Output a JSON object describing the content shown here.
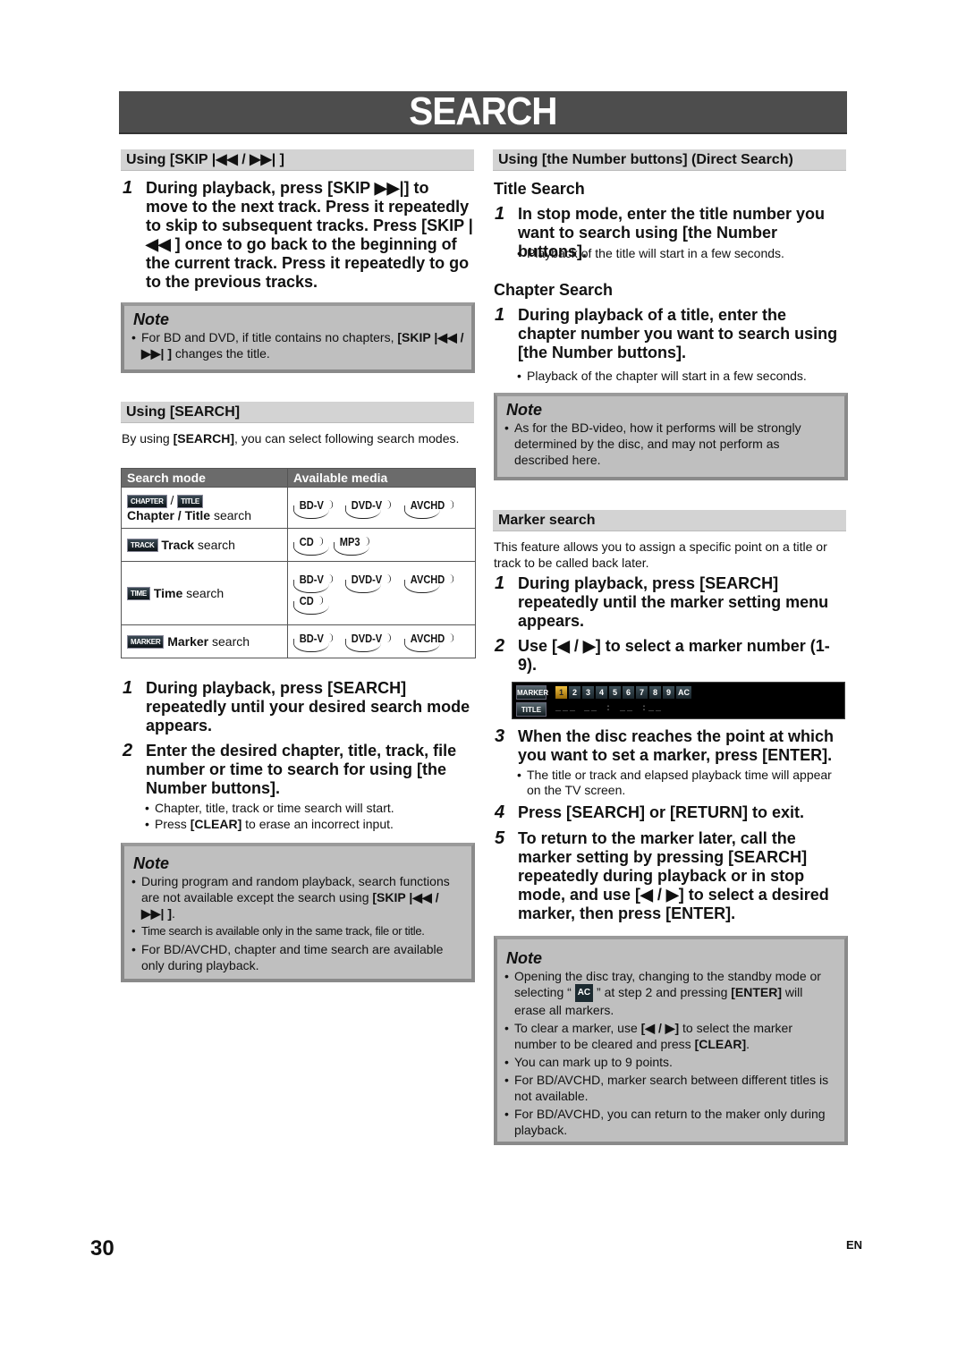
{
  "page": {
    "title": "SEARCH",
    "page_number": "30",
    "language": "EN"
  },
  "left": {
    "skip": {
      "heading": "Using [SKIP |◀◀ / ▶▶| ]",
      "step1_num": "1",
      "step1": "During playback, press [SKIP ▶▶|] to move to the next track. Press it repeatedly to skip to subsequent tracks. Press [SKIP |◀◀ ] once to go back to the beginning of the current track. Press it repeatedly to go to the previous tracks.",
      "note_title": "Note",
      "note_items": [
        {
          "pre": "For BD and DVD, if title contains no chapters, ",
          "bold": "[SKIP |◀◀ / ▶▶| ]",
          "post": " changes the title."
        }
      ]
    },
    "search": {
      "heading": "Using [SEARCH]",
      "intro_pre": "By using ",
      "intro_bold": "[SEARCH]",
      "intro_post": ", you can select following search modes.",
      "table": {
        "headers": [
          "Search mode",
          "Available media"
        ],
        "rows": [
          {
            "badges": [
              "CHAPTER",
              "TITLE"
            ],
            "bold": "Chapter / Title",
            "text": " search",
            "media": [
              [
                "BD-V",
                "DVD-V",
                "AVCHD"
              ]
            ]
          },
          {
            "badges": [
              "TRACK"
            ],
            "bold": "Track",
            "text": " search",
            "media": [
              [
                "CD",
                "MP3"
              ]
            ]
          },
          {
            "badges": [
              "TIME"
            ],
            "bold": "Time",
            "text": " search",
            "media": [
              [
                "BD-V",
                "DVD-V",
                "AVCHD"
              ],
              [
                "CD"
              ]
            ]
          },
          {
            "badges": [
              "MARKER"
            ],
            "bold": "Marker",
            "text": " search",
            "media": [
              [
                "BD-V",
                "DVD-V",
                "AVCHD"
              ]
            ]
          }
        ]
      },
      "steps": [
        {
          "num": "1",
          "text": "During playback, press [SEARCH] repeatedly until your desired search mode appears."
        },
        {
          "num": "2",
          "text": "Enter the desired chapter, title, track, file number or time to search for using [the Number buttons]."
        }
      ],
      "bullets": [
        {
          "pre": "Chapter, title, track or time search will start.",
          "bold": "",
          "post": ""
        },
        {
          "pre": "Press ",
          "bold": "[CLEAR]",
          "post": " to erase an incorrect input."
        }
      ],
      "note_title": "Note",
      "note_items": [
        {
          "pre": "During program and random playback, search functions are not available except the search using ",
          "bold": "[SKIP |◀◀ / ▶▶| ]",
          "post": "."
        },
        {
          "pre": "Time search is available only in the same track, file or title.",
          "bold": "",
          "post": ""
        },
        {
          "pre": "For BD/AVCHD, chapter and time search are available only during playback.",
          "bold": "",
          "post": ""
        }
      ]
    }
  },
  "right": {
    "direct": {
      "heading": "Using [the Number buttons] (Direct Search)",
      "title_search": {
        "heading": "Title Search",
        "step_num": "1",
        "step": "In stop mode, enter the title number you want to search using [the Number buttons].",
        "bullet": "Playback of the title will start in a few seconds."
      },
      "chapter_search": {
        "heading": "Chapter Search",
        "step_num": "1",
        "step": "During playback of a title, enter the chapter number you want to search using [the Number buttons].",
        "bullet": "Playback of the chapter will start in a few seconds."
      },
      "note_title": "Note",
      "note_items": [
        "As for the BD-video, how it performs will be strongly determined by the disc, and may not perform as described here."
      ]
    },
    "marker": {
      "heading": "Marker search",
      "intro": "This feature allows you to assign a specific point on a title or track to be called back later.",
      "steps": [
        {
          "num": "1",
          "text": "During playback, press [SEARCH] repeatedly until the marker setting menu appears."
        },
        {
          "num": "2",
          "text": "Use [◀ / ▶] to select a marker number (1-9)."
        },
        {
          "num": "3",
          "text": "When the disc reaches the point at which you want to set a marker, press [ENTER]."
        },
        {
          "num": "4",
          "text": "Press [SEARCH] or [RETURN] to exit."
        },
        {
          "num": "5",
          "text": "To return to the marker later, call the marker setting by pressing [SEARCH] repeatedly during playback or in stop mode, and use [◀ / ▶] to select a desired marker, then press [ENTER]."
        }
      ],
      "step3_bullet": "The title or track and elapsed playback time will appear on the TV screen.",
      "osd": {
        "marker_label": "MARKER",
        "title_label": "TITLE",
        "cells": [
          "1",
          "2",
          "3",
          "4",
          "5",
          "6",
          "7",
          "8",
          "9",
          "AC"
        ],
        "selected": "1",
        "time_placeholder": "___  __ : __ :__"
      },
      "note_title": "Note",
      "note_items": [
        {
          "pre": "Opening the disc tray, changing to the standby mode or selecting “ ",
          "chip": "AC",
          "mid": " ” at step 2 and pressing ",
          "bold": "[ENTER]",
          "post": " will erase all markers."
        },
        {
          "pre": "To clear a marker, use ",
          "bold": "[◀ / ▶]",
          "post": " to select the marker number to be cleared and press ",
          "bold2": "[CLEAR]",
          "post2": "."
        },
        {
          "pre": "You can mark up to 9 points."
        },
        {
          "pre": "For BD/AVCHD, marker search between different titles is not available."
        },
        {
          "pre": "For BD/AVCHD, you can return to the maker only during playback."
        }
      ]
    }
  }
}
